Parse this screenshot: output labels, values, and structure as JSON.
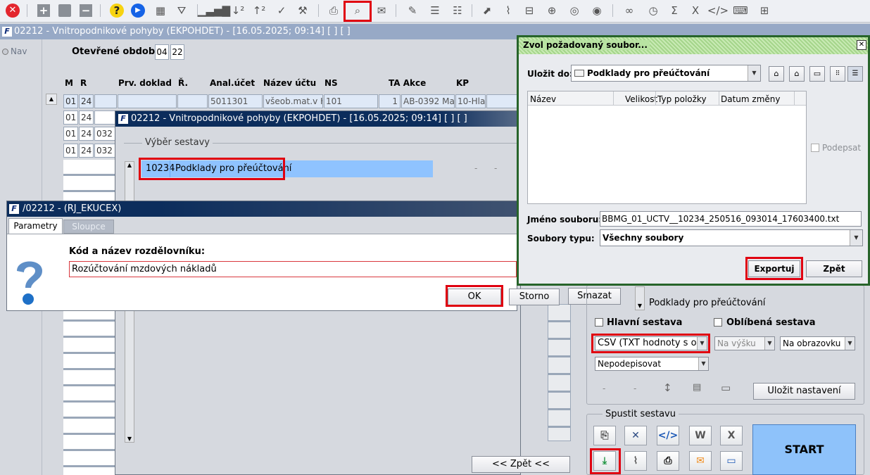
{
  "toolbar": {
    "icons": [
      "close-icon",
      "add-icon",
      "save-icon",
      "delete-icon",
      "help-icon",
      "play-icon",
      "calendar-icon",
      "filter-icon",
      "bars-icon",
      "sort-asc-icon",
      "sort-desc-icon",
      "check-icon",
      "wrench-icon",
      "print-icon",
      "print-preview-icon",
      "mail-icon",
      "edit-icon",
      "list-icon",
      "checklist-icon",
      "open-icon",
      "attach-icon",
      "signpost-icon",
      "globe-icon",
      "compass-icon",
      "eye-icon",
      "glasses-icon",
      "clock-icon",
      "sum-icon",
      "excel-icon",
      "code-icon",
      "keyboard-icon",
      "tree-icon"
    ]
  },
  "main": {
    "title": "02212 - Vnitropodnikové pohyby (EKPOHDET) - [16.05.2025; 09:14]  [ ]  [ ]",
    "nav_label": "Nav",
    "period_label": "Otevřené období",
    "period_month": "04",
    "period_year": "22",
    "columns": [
      "M",
      "R",
      "Prv. doklad",
      "Ř.",
      "Anal.účet",
      "Název účtu",
      "NS",
      "TA Akce",
      "KP"
    ],
    "row1": {
      "m": "01",
      "r": "24",
      "anal": "5011301",
      "nazev": "všeob.mat.v H",
      "ns": "101",
      "ta": "1",
      "akce": "AB-0392 Ma",
      "kp": "10-Hla"
    },
    "rows": [
      {
        "m": "01",
        "r": "24",
        "c": ""
      },
      {
        "m": "01",
        "r": "24",
        "c": "032"
      },
      {
        "m": "01",
        "r": "24",
        "c": "032"
      }
    ],
    "back_label": "<< Zpět <<"
  },
  "report_dialog": {
    "title": "02212 - Vnitropodnikové pohyby (EKPOHDET) - [16.05.2025; 09:14]  [ ]  [ ]",
    "section": "Výběr sestavy",
    "item_code": "10234",
    "item_name": "Podklady pro přeúčtování"
  },
  "param_dialog": {
    "title": "/02212 - (RJ_EKUCEX)",
    "tabs": [
      "Parametry",
      "Sloupce"
    ],
    "field_label": "Kód a název rozdělovníku:",
    "field_value": "Rozúčtování mzdových nákladů",
    "ok": "OK",
    "cancel": "Storno",
    "clear": "Smazat"
  },
  "save_dialog": {
    "title": "Zvol požadovaný soubor...",
    "save_in_label": "Uložit do:",
    "save_in_value": "Podklady pro přeúčtování",
    "columns": [
      "Název",
      "Velikost",
      "Typ položky",
      "Datum změny"
    ],
    "sign_label": "Podepsat",
    "filename_label": "Jméno souboru:",
    "filename_value": "BBMG_01_UCTV__10234_250516_093014_17603400.txt",
    "filetype_label": "Soubory typu:",
    "filetype_value": "Všechny soubory",
    "export": "Exportuj",
    "back": "Zpět"
  },
  "settings": {
    "report_name": "Podklady pro přeúčtování",
    "main_report": "Hlavní sestava",
    "fav_report": "Oblíbená sestava",
    "format": "CSV (TXT hodnoty s o...",
    "orientation": "Na výšku",
    "output": "Na obrazovku",
    "signing": "Nepodepisovat",
    "save_settings": "Uložit nastavení",
    "run_section": "Spustit sestavu",
    "start": "START"
  }
}
